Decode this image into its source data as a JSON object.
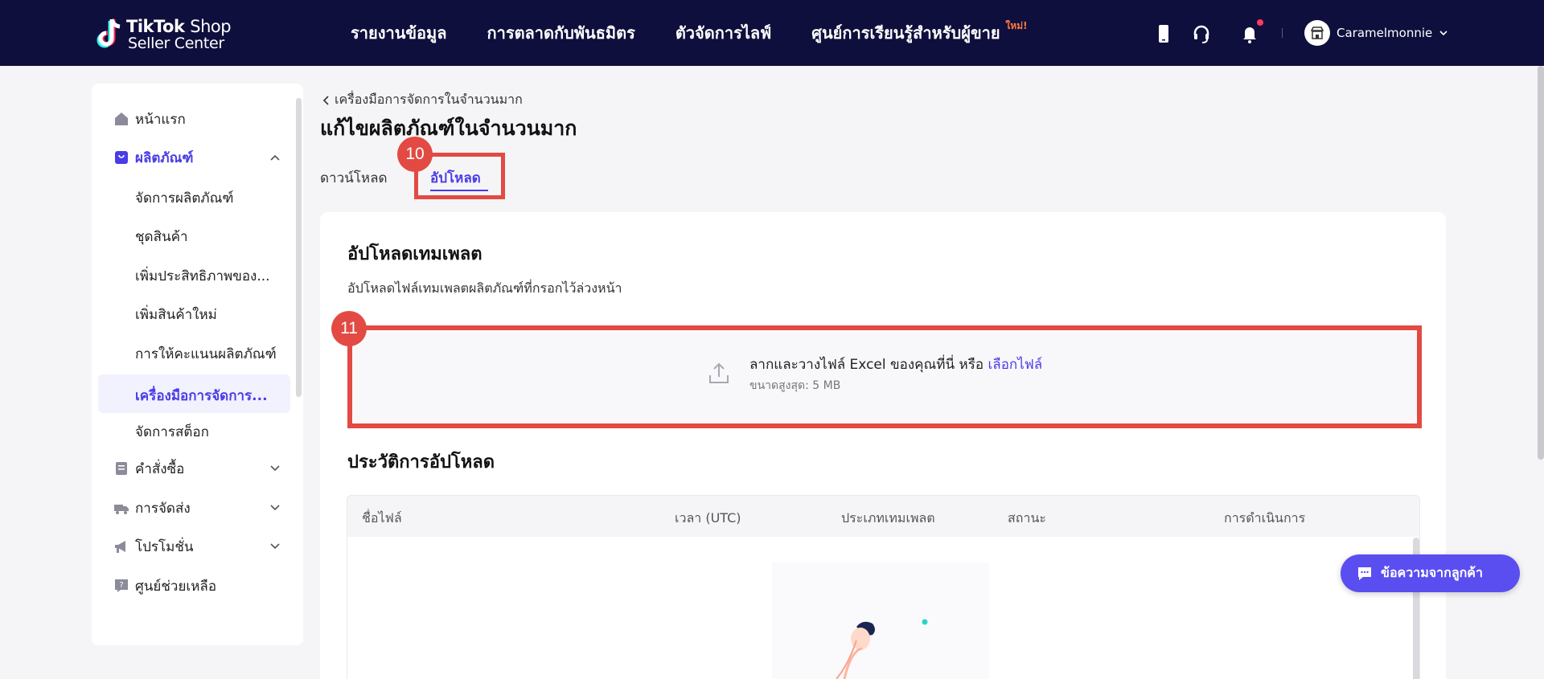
{
  "colors": {
    "topbar": "#0f0f3d",
    "accent": "#4a3de6",
    "highlight": "#e24a43",
    "badge_new": "#fe7a3a"
  },
  "logo": {
    "brand_bold": "TikTok",
    "brand_light": "Shop",
    "sub": "Seller Center"
  },
  "nav": {
    "items": [
      "รายงานข้อมูล",
      "การตลาดกับพันธมิตร",
      "ตัวจัดการไลฟ์",
      "ศูนย์การเรียนรู้สำหรับผู้ขาย"
    ],
    "new_badge": "ใหม่!"
  },
  "top_icons": [
    "phone-icon",
    "headset-icon",
    "bell-icon"
  ],
  "account": {
    "name": "Caramelmonnie"
  },
  "sidebar": {
    "home": "หน้าแรก",
    "products": "ผลิตภัณฑ์",
    "product_sub": [
      "จัดการผลิตภัณฑ์",
      "ชุดสินค้า",
      "เพิ่มประสิทธิภาพของ...",
      "เพิ่มสินค้าใหม่",
      "การให้คะแนนผลิตภัณฑ์",
      "เครื่องมือการจัดการ...",
      "จัดการสต็อก"
    ],
    "orders": "คำสั่งซื้อ",
    "shipping": "การจัดส่ง",
    "promotions": "โปรโมชั่น",
    "help": "ศูนย์ช่วยเหลือ"
  },
  "breadcrumb": "เครื่องมือการจัดการในจำนวนมาก",
  "page_title": "แก้ไขผลิตภัณฑ์ในจำนวนมาก",
  "tabs": {
    "download": "ดาวน์โหลด",
    "upload": "อัปโหลด"
  },
  "upload_section": {
    "title": "อัปโหลดเทมเพลต",
    "description": "อัปโหลดไฟล์เทมเพลตผลิตภัณฑ์ที่กรอกไว้ล่วงหน้า",
    "drop_text": "ลากและวางไฟล์ Excel ของคุณที่นี่ หรือ",
    "drop_link": "เลือกไฟล์",
    "max_size": "ขนาดสูงสุด: 5 MB"
  },
  "history": {
    "title": "ประวัติการอัปโหลด",
    "columns": [
      "ชื่อไฟล์",
      "เวลา (UTC)",
      "ประเภทเทมเพลต",
      "สถานะ",
      "การดำเนินการ"
    ]
  },
  "annotations": {
    "step_10": "10",
    "step_11": "11"
  },
  "chat": {
    "label": "ข้อความจากลูกค้า"
  }
}
